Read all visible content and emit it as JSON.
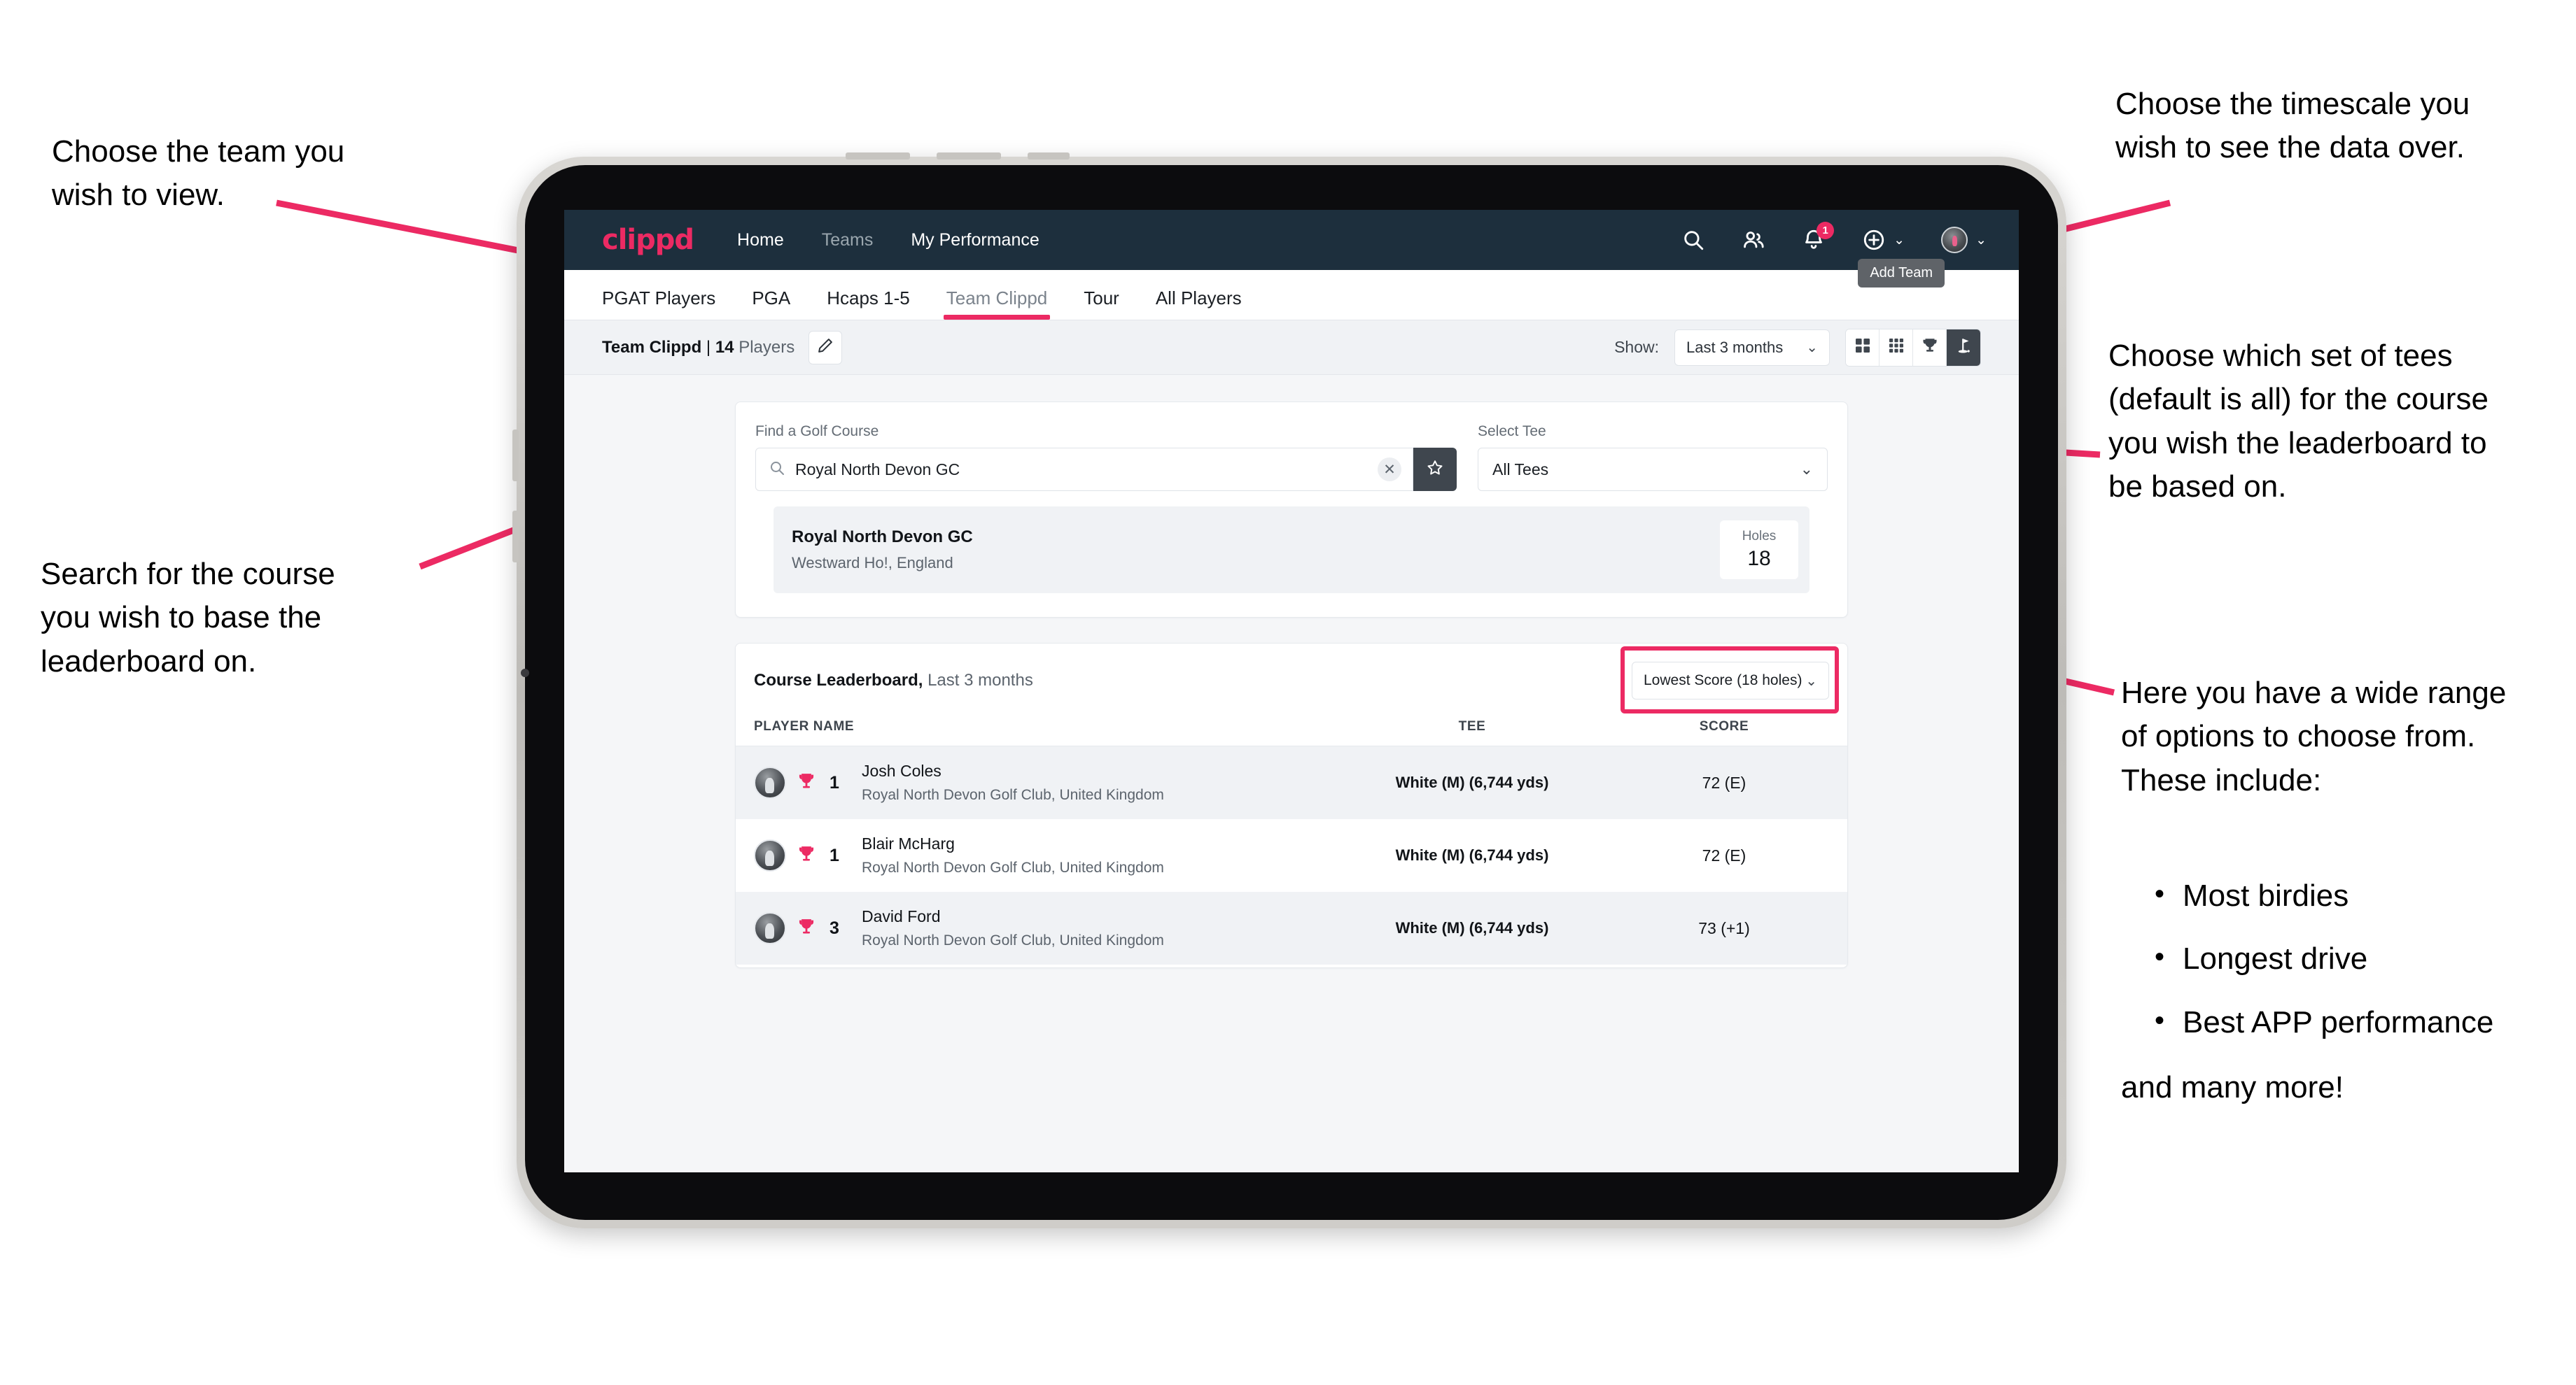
{
  "annotations": {
    "top_left": "Choose the team you\nwish to view.",
    "bottom_left": "Search for the course\nyou wish to base the\nleaderboard on.",
    "top_right": "Choose the timescale you\nwish to see the data over.",
    "middle_right": "Choose which set of tees\n(default is all) for the course\nyou wish the leaderboard to\nbe based on.",
    "bottom_right": "Here you have a wide range\nof options to choose from.\nThese include:",
    "bullets": [
      "Most birdies",
      "Longest drive",
      "Best APP performance"
    ],
    "closing": "and many more!"
  },
  "colors": {
    "accent_pink": "#ec2a63",
    "navbar_dark": "#1d2f3d",
    "toolbar_grey": "#f0f2f5",
    "active_toggle": "#3f464e"
  },
  "app": {
    "brand": "clippd",
    "nav_links": [
      {
        "label": "Home",
        "active": true
      },
      {
        "label": "Teams",
        "active": false
      },
      {
        "label": "My Performance",
        "active": true
      }
    ],
    "nav_icons": {
      "search": "search-icon",
      "people": "people-icon",
      "notifications": "bell-icon",
      "notification_count": "1",
      "add": "plus-circle-icon",
      "profile": "avatar-icon"
    },
    "tooltip": "Add Team",
    "tabs": [
      {
        "label": "PGAT Players",
        "active": false
      },
      {
        "label": "PGA",
        "active": false
      },
      {
        "label": "Hcaps 1-5",
        "active": false
      },
      {
        "label": "Team Clippd",
        "active": true
      },
      {
        "label": "Tour",
        "active": false
      },
      {
        "label": "All Players",
        "active": false
      }
    ],
    "toolbar": {
      "team_name": "Team Clippd",
      "separator": " | ",
      "player_count": "14",
      "players_word": "Players",
      "edit_icon": "pencil-icon",
      "show_label": "Show:",
      "timescale_value": "Last 3 months",
      "view_toggles": [
        {
          "icon": "grid-2x2-icon",
          "active": false
        },
        {
          "icon": "grid-3x3-icon",
          "active": false
        },
        {
          "icon": "trophy-icon",
          "active": false
        },
        {
          "icon": "golf-flag-icon",
          "active": true
        }
      ]
    },
    "search_panel": {
      "course_label": "Find a Golf Course",
      "course_value": "Royal North Devon GC",
      "course_placeholder": "Find a Golf Course",
      "clear_icon": "close-icon",
      "favorite_icon": "star-icon",
      "tee_label": "Select Tee",
      "tee_value": "All Tees"
    },
    "course_result": {
      "name": "Royal North Devon GC",
      "location": "Westward Ho!, England",
      "holes_label": "Holes",
      "holes_value": "18"
    },
    "leaderboard": {
      "title": "Course Leaderboard,",
      "subtitle": " Last 3 months",
      "metric_value": "Lowest Score (18 holes)",
      "columns": [
        "PLAYER NAME",
        "TEE",
        "SCORE"
      ],
      "rows": [
        {
          "rank": "1",
          "name": "Josh Coles",
          "club": "Royal North Devon Golf Club, United Kingdom",
          "tee": "White (M) (6,744 yds)",
          "score": "72 (E)"
        },
        {
          "rank": "1",
          "name": "Blair McHarg",
          "club": "Royal North Devon Golf Club, United Kingdom",
          "tee": "White (M) (6,744 yds)",
          "score": "72 (E)"
        },
        {
          "rank": "3",
          "name": "David Ford",
          "club": "Royal North Devon Golf Club, United Kingdom",
          "tee": "White (M) (6,744 yds)",
          "score": "73 (+1)"
        }
      ]
    }
  }
}
